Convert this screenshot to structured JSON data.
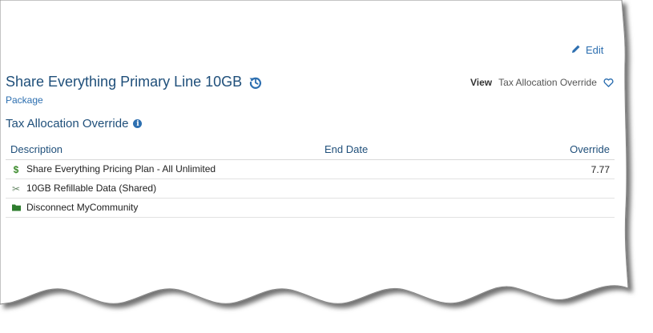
{
  "header": {
    "edit_label": "Edit",
    "title": "Share Everything Primary Line 10GB",
    "subtitle": "Package",
    "view_label": "View",
    "view_value": "Tax Allocation Override"
  },
  "section": {
    "title": "Tax Allocation Override",
    "info_glyph": "i"
  },
  "table": {
    "columns": [
      "Description",
      "End Date",
      "Override"
    ],
    "rows": [
      {
        "icon": "dollar-icon",
        "glyph": "$",
        "description": "Share Everything Pricing Plan - All Unlimited",
        "end_date": "",
        "override": "7.77"
      },
      {
        "icon": "scissors-icon",
        "glyph": "✂",
        "description": "10GB Refillable Data (Shared)",
        "end_date": "",
        "override": ""
      },
      {
        "icon": "folder-icon",
        "glyph": "",
        "description": "Disconnect MyCommunity",
        "end_date": "",
        "override": ""
      }
    ]
  },
  "colors": {
    "accent": "#2d6fb0",
    "title": "#1f4f7a",
    "green": "#3a8a2a"
  }
}
